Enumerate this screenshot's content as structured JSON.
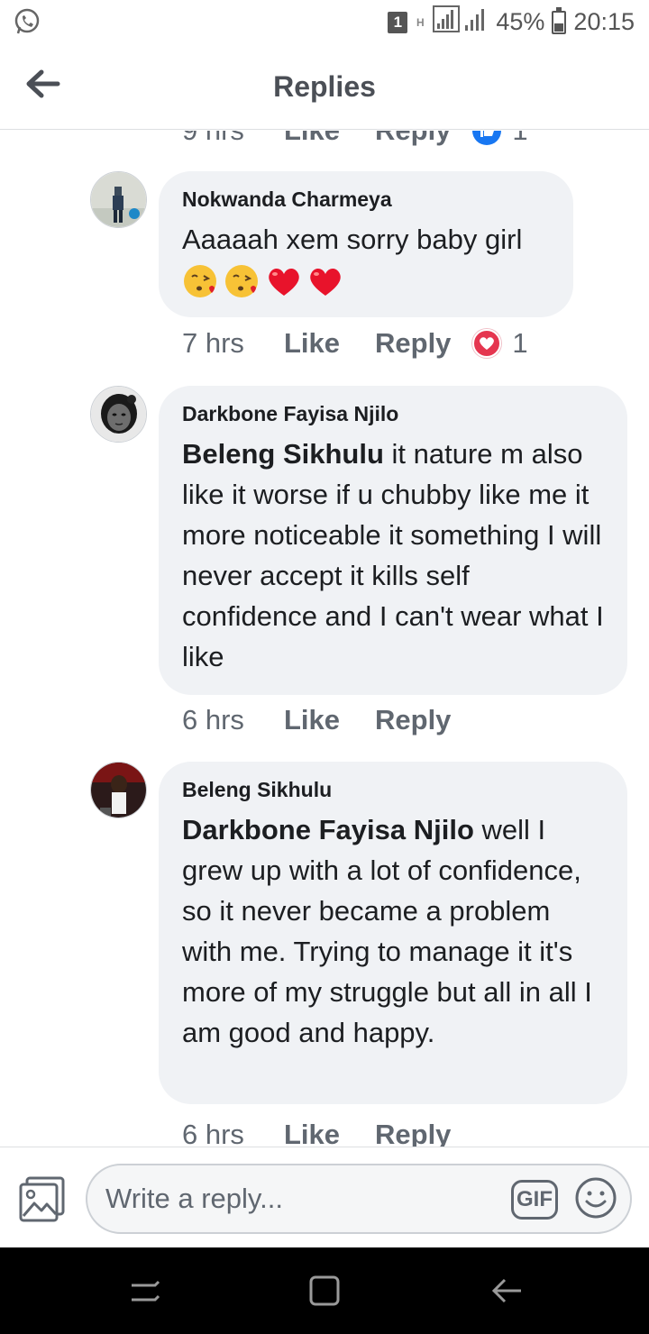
{
  "status_bar": {
    "sim_badge": "1",
    "network_type": "H",
    "battery_percent": "45%",
    "battery_level": 0.45,
    "time": "20:15",
    "notification_icon": "whatsapp-icon"
  },
  "header": {
    "title": "Replies",
    "back_icon": "back-arrow-icon"
  },
  "partial_meta_top": {
    "time": "9 hrs",
    "like": "Like",
    "reply": "Reply",
    "reaction_count": "1",
    "reaction": "like"
  },
  "comments": [
    {
      "author": "Nokwanda Charmeya",
      "mention": "",
      "text": "Aaaaah xem sorry baby girl",
      "emojis": [
        "😘",
        "😘",
        "❤️",
        "❤️"
      ],
      "time": "7 hrs",
      "like": "Like",
      "reply": "Reply",
      "reaction": "love",
      "reaction_count": "1"
    },
    {
      "author": "Darkbone Fayisa Njilo",
      "mention": "Beleng Sikhulu",
      "text": " it nature m also like it worse if u chubby like me it more noticeable it something I will never accept it kills self confidence and I can't wear what I like",
      "time": "6 hrs",
      "like": "Like",
      "reply": "Reply"
    },
    {
      "author": "Beleng Sikhulu",
      "mention": "Darkbone Fayisa Njilo",
      "text": " well I grew up with a lot of confidence, so it never became a problem with me. Trying to manage it it's more of my struggle but all in all I am good and happy.",
      "time": "6 hrs",
      "like": "Like",
      "reply": "Reply"
    }
  ],
  "composer": {
    "placeholder": "Write a reply...",
    "gif_label": "GIF"
  },
  "colors": {
    "bubble": "#f0f2f5",
    "meta_text": "#606770",
    "love_reaction": "#e5354f",
    "like_reaction": "#1877f2",
    "nav_bar": "#000000"
  }
}
